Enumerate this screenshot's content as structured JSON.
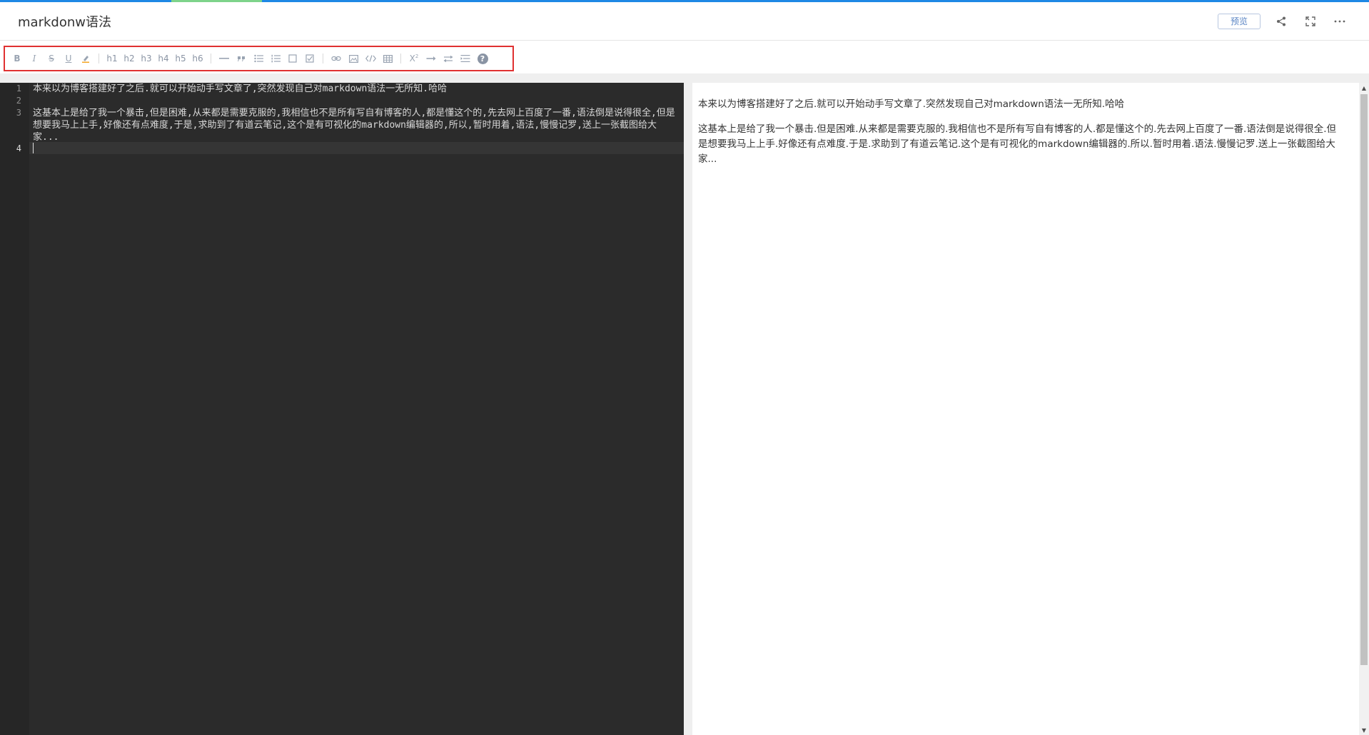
{
  "header": {
    "title": "markdonw语法",
    "preview_label": "预览",
    "icons": [
      "share-icon",
      "fullscreen-icon",
      "more-icon"
    ]
  },
  "toolbar": {
    "buttons": [
      {
        "name": "bold-button",
        "glyph": "B"
      },
      {
        "name": "italic-button",
        "glyph": "I"
      },
      {
        "name": "strikethrough-button",
        "glyph": "S"
      },
      {
        "name": "underline-button",
        "glyph": "U"
      },
      {
        "name": "highlight-button",
        "glyph": "highlighter-icon"
      },
      {
        "name": "h1-button",
        "glyph": "h1"
      },
      {
        "name": "h2-button",
        "glyph": "h2"
      },
      {
        "name": "h3-button",
        "glyph": "h3"
      },
      {
        "name": "h4-button",
        "glyph": "h4"
      },
      {
        "name": "h5-button",
        "glyph": "h5"
      },
      {
        "name": "h6-button",
        "glyph": "h6"
      },
      {
        "name": "horizontal-rule-button",
        "glyph": "hr-icon"
      },
      {
        "name": "quote-button",
        "glyph": "quote-icon"
      },
      {
        "name": "unordered-list-button",
        "glyph": "ul-icon"
      },
      {
        "name": "ordered-list-button",
        "glyph": "ol-icon"
      },
      {
        "name": "checkbox-button",
        "glyph": "checkbox-icon"
      },
      {
        "name": "checked-checkbox-button",
        "glyph": "checked-checkbox-icon"
      },
      {
        "name": "link-button",
        "glyph": "link-icon"
      },
      {
        "name": "image-button",
        "glyph": "image-icon"
      },
      {
        "name": "code-button",
        "glyph": "code-icon"
      },
      {
        "name": "table-button",
        "glyph": "table-icon"
      },
      {
        "name": "superscript-button",
        "glyph": "X²"
      },
      {
        "name": "arrow-right-button",
        "glyph": "arrow-right-icon"
      },
      {
        "name": "swap-button",
        "glyph": "swap-icon"
      },
      {
        "name": "indent-button",
        "glyph": "indent-icon"
      },
      {
        "name": "help-button",
        "glyph": "?"
      }
    ],
    "labels": {
      "bold": "B",
      "italic": "I",
      "strike": "S",
      "underline": "U",
      "h1": "h1",
      "h2": "h2",
      "h3": "h3",
      "h4": "h4",
      "h5": "h5",
      "h6": "h6",
      "sup": "X",
      "sup2": "2",
      "help": "?"
    }
  },
  "editor": {
    "line_numbers": [
      "1",
      "2",
      "3",
      "4"
    ],
    "lines": [
      "本来以为博客搭建好了之后.就可以开始动手写文章了,突然发现自己对markdown语法一无所知.哈哈",
      "",
      "这基本上是给了我一个暴击,但是困难,从来都是需要克服的,我相信也不是所有写自有博客的人,都是懂这个的,先去网上百度了一番,语法倒是说得很全,但是想要我马上上手,好像还有点难度,于是,求助到了有道云笔记,这个是有可视化的markdown编辑器的,所以,暂时用着,语法,慢慢记罗,送上一张截图给大家...",
      ""
    ]
  },
  "preview": {
    "paragraphs": [
      "本来以为博客搭建好了之后.就可以开始动手写文章了.突然发现自己对markdown语法一无所知.哈哈",
      "这基本上是给了我一个暴击.但是困难.从来都是需要克服的.我相信也不是所有写自有博客的人.都是懂这个的.先去网上百度了一番.语法倒是说得很全.但是想要我马上上手.好像还有点难度.于是.求助到了有道云笔记.这个是有可视化的markdown编辑器的.所以.暂时用着.语法.慢慢记罗.送上一张截图给大家..."
    ]
  },
  "colors": {
    "accent": "#1e88e5",
    "toolbar_highlight": "#e03131",
    "editor_bg": "#2b2b2b"
  }
}
